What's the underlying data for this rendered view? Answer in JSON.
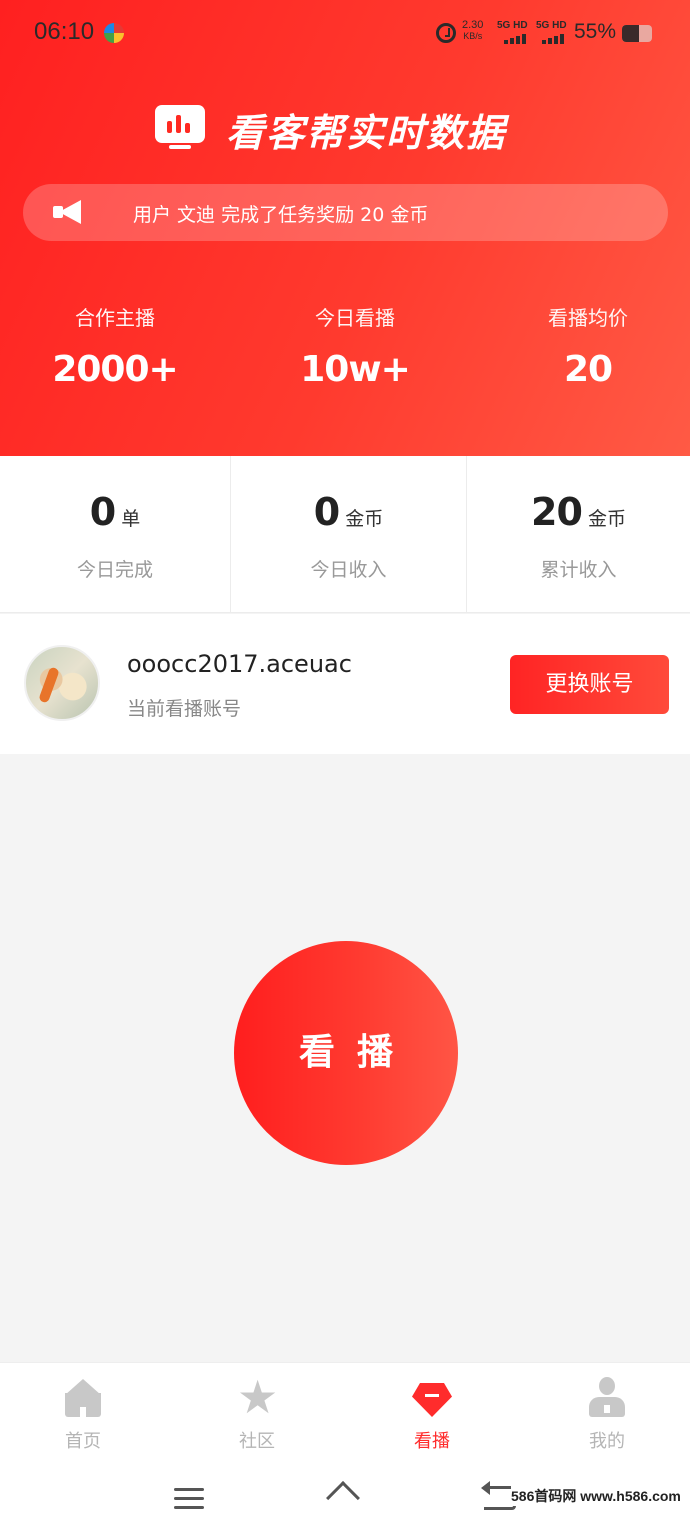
{
  "status_bar": {
    "time": "06:10",
    "net_speed_value": "2.30",
    "net_speed_unit": "KB/s",
    "sim1": "5G HD",
    "sim2": "5G HD",
    "battery_text": "55%",
    "battery_level": 0.55
  },
  "header": {
    "title": "看客帮实时数据",
    "notice": "用户 文迪 完成了任务奖励 20 金币",
    "stats": [
      {
        "label": "合作主播",
        "value": "2000+"
      },
      {
        "label": "今日看播",
        "value": "10w+"
      },
      {
        "label": "看播均价",
        "value": "20"
      }
    ]
  },
  "summary": [
    {
      "number": "0",
      "unit": "单",
      "caption": "今日完成"
    },
    {
      "number": "0",
      "unit": "金币",
      "caption": "今日收入"
    },
    {
      "number": "20",
      "unit": "金币",
      "caption": "累计收入"
    }
  ],
  "account": {
    "name": "ooocc2017.aceuac",
    "subtitle": "当前看播账号",
    "switch_label": "更换账号"
  },
  "main_button": "看播",
  "tabs": [
    {
      "label": "首页",
      "icon": "home-icon",
      "active": false
    },
    {
      "label": "社区",
      "icon": "star-icon",
      "active": false
    },
    {
      "label": "看播",
      "icon": "live-icon",
      "active": true
    },
    {
      "label": "我的",
      "icon": "user-icon",
      "active": false
    }
  ],
  "watermark": "586首码网 www.h586.com",
  "colors": {
    "accent": "#ff2c2c",
    "muted": "#999999"
  }
}
